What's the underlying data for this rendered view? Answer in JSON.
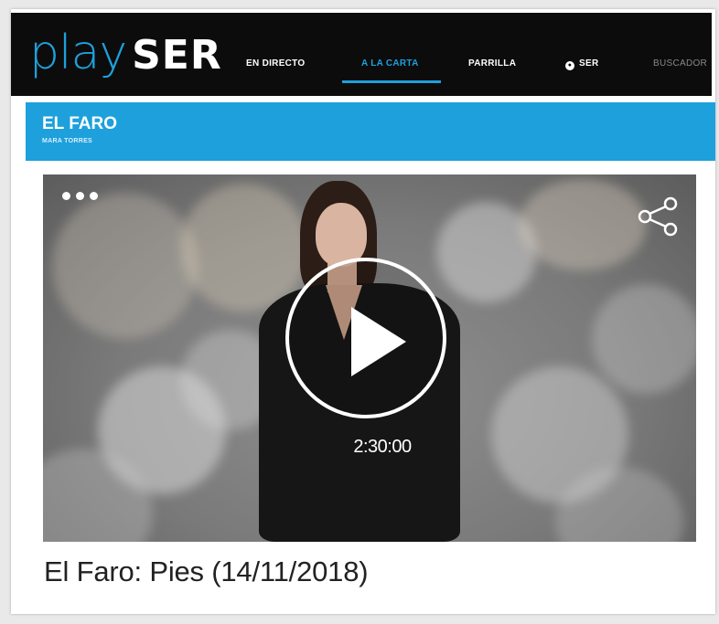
{
  "brand": {
    "play": "play",
    "ser": "SER"
  },
  "nav": {
    "items": [
      {
        "label": "EN DIRECTO"
      },
      {
        "label": "A LA CARTA"
      },
      {
        "label": "PARRILLA"
      },
      {
        "label": "SER"
      },
      {
        "label": "BUSCADOR"
      }
    ],
    "active": "A LA CARTA"
  },
  "program": {
    "title": "EL FARO",
    "subtitle": "MARA TORRES"
  },
  "player": {
    "duration": "2:30:00",
    "more_icon": "more-dots-icon",
    "share_icon": "share-icon",
    "play_icon": "play-icon"
  },
  "episode": {
    "title": "El Faro: Pies (14/11/2018)"
  },
  "colors": {
    "accent": "#1ea0dc",
    "topbar": "#0c0c0c"
  }
}
